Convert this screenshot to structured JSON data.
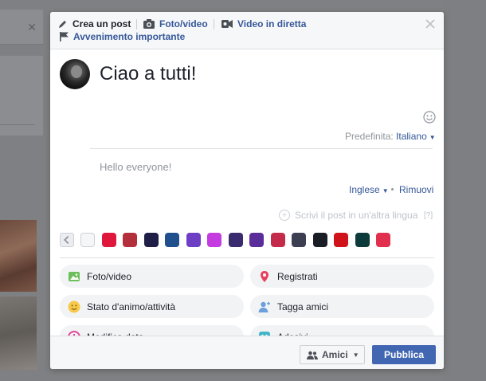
{
  "header": {
    "tabs": {
      "create_post": "Crea un post",
      "photo_video": "Foto/video",
      "live_video": "Video in diretta",
      "life_event": "Avvenimento importante"
    }
  },
  "composer": {
    "post_text": "Ciao a tutti!",
    "default_language_label": "Predefinita:",
    "default_language_value": "Italiano",
    "translation_text": "Hello everyone!",
    "translation_language": "Inglese",
    "remove_label": "Rimuovi",
    "write_other_language": "Scrivi il post in un'altra lingua",
    "help_label": "[?]"
  },
  "backgrounds": {
    "colors": [
      "#f5f6f7",
      "#e0173c",
      "#b32f3c",
      "#1e1e46",
      "#1f4f8c",
      "#6c3fc4",
      "#c43be0",
      "#3a2a6e",
      "#5b2d9a",
      "#c42b4a",
      "#3c3f52",
      "#1a1d24",
      "#d0121b",
      "#0d3a3a",
      "#e0304e"
    ]
  },
  "actions": {
    "photo_video": "Foto/video",
    "check_in": "Registrati",
    "feeling": "Stato d'animo/attività",
    "tag_friends": "Tagga amici",
    "edit_date": "Modifica data",
    "stickers": "Adesivi"
  },
  "footer": {
    "audience": "Amici",
    "publish": "Pubblica"
  },
  "colors": {
    "accent": "#4267b2",
    "link": "#365899"
  }
}
